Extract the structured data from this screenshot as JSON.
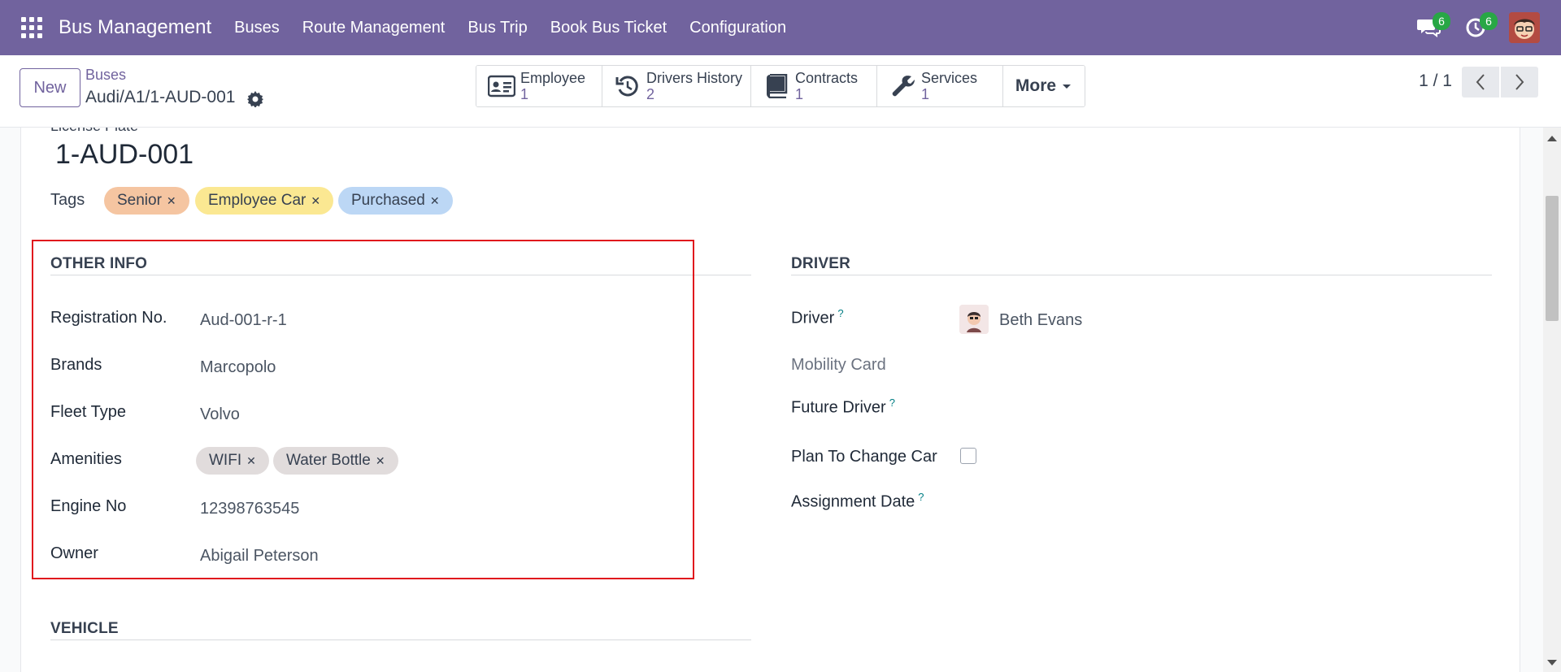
{
  "navbar": {
    "brand": "Bus Management",
    "menu": [
      "Buses",
      "Route Management",
      "Bus Trip",
      "Book Bus Ticket",
      "Configuration"
    ],
    "messages_count": "6",
    "activities_count": "6",
    "bg_color": "#71639e"
  },
  "control": {
    "new_label": "New",
    "breadcrumb_parent": "Buses",
    "breadcrumb_current": "Audi/A1/1-AUD-001",
    "smart_buttons": [
      {
        "label": "Employee",
        "count": "1",
        "icon": "id-card-icon"
      },
      {
        "label": "Drivers History",
        "count": "2",
        "icon": "history-icon"
      },
      {
        "label": "Contracts",
        "count": "1",
        "icon": "book-icon"
      },
      {
        "label": "Services",
        "count": "1",
        "icon": "wrench-icon"
      }
    ],
    "more_label": "More",
    "pager": "1 / 1"
  },
  "form": {
    "clipped_label": "License Plate",
    "license_plate": "1-AUD-001",
    "tags_label": "Tags",
    "tags": [
      {
        "label": "Senior",
        "color": "#f5c5a1"
      },
      {
        "label": "Employee Car",
        "color": "#fbe892"
      },
      {
        "label": "Purchased",
        "color": "#bcd7f5"
      }
    ],
    "other_info": {
      "title": "OTHER INFO",
      "registration_label": "Registration No.",
      "registration_value": "Aud-001-r-1",
      "brands_label": "Brands",
      "brands_value": "Marcopolo",
      "fleet_type_label": "Fleet Type",
      "fleet_type_value": "Volvo",
      "amenities_label": "Amenities",
      "amenities": [
        "WIFI",
        "Water Bottle"
      ],
      "engine_label": "Engine No",
      "engine_value": "12398763545",
      "owner_label": "Owner",
      "owner_value": "Abigail Peterson"
    },
    "driver": {
      "title": "DRIVER",
      "driver_label": "Driver",
      "driver_value": "Beth Evans",
      "mobility_label": "Mobility Card",
      "future_driver_label": "Future Driver",
      "plan_change_label": "Plan To Change Car",
      "assignment_label": "Assignment Date",
      "help_mark": "?"
    },
    "vehicle_title": "VEHICLE",
    "highlight_color": "#e0181d"
  }
}
